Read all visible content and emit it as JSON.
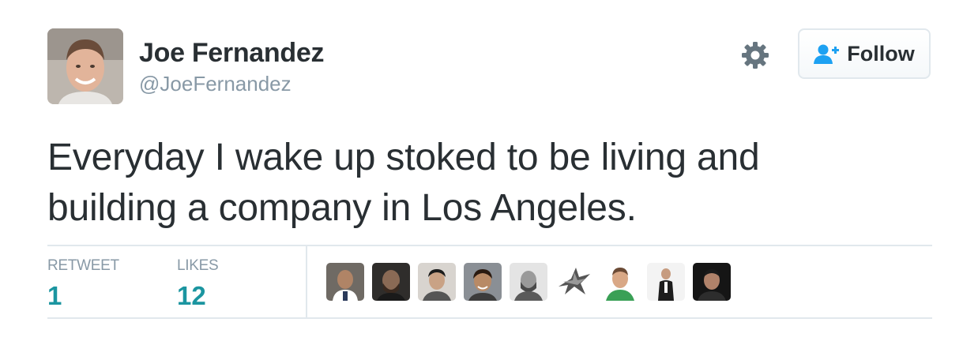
{
  "author": {
    "name": "Joe Fernandez",
    "handle": "@JoeFernandez",
    "avatar_icon": "profile-photo"
  },
  "actions": {
    "settings_icon": "gear-icon",
    "follow_icon": "add-user-icon",
    "follow_label": "Follow"
  },
  "tweet": {
    "text_line1": "Everyday I wake up stoked to be living and",
    "text_line2": "building a company in Los Angeles."
  },
  "stats": {
    "retweet_label": "RETWEET",
    "retweet_count": "1",
    "likes_label": "LIKES",
    "likes_count": "12"
  },
  "likers": [
    {
      "icon": "liker-avatar-1"
    },
    {
      "icon": "liker-avatar-2"
    },
    {
      "icon": "liker-avatar-3"
    },
    {
      "icon": "liker-avatar-4"
    },
    {
      "icon": "liker-avatar-5"
    },
    {
      "icon": "liker-avatar-6"
    },
    {
      "icon": "liker-avatar-7"
    },
    {
      "icon": "liker-avatar-8"
    },
    {
      "icon": "liker-avatar-9"
    }
  ],
  "colors": {
    "text": "#292f33",
    "muted": "#8899a6",
    "stat_value": "#1b95a0",
    "follow_icon": "#1da1f2",
    "border": "#e1e8ed"
  }
}
